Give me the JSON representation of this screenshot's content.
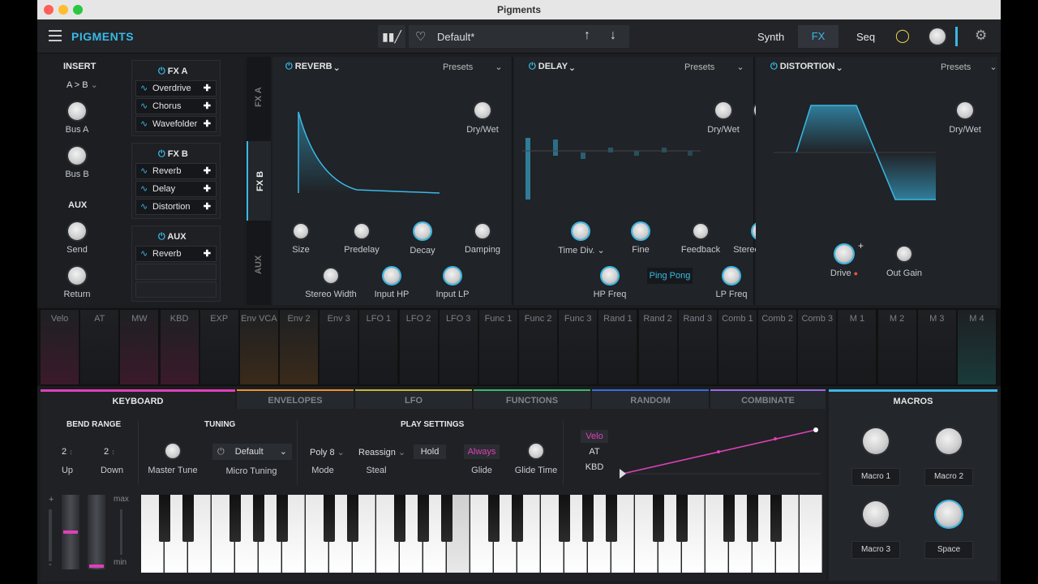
{
  "window": {
    "title": "Pigments"
  },
  "topbar": {
    "logo": "PIGMENTS",
    "preset_name": "Default*",
    "nav_synth": "Synth",
    "nav_fx": "FX",
    "nav_seq": "Seq"
  },
  "insert": {
    "title": "INSERT",
    "routing": "A > B",
    "bus_a": "Bus A",
    "bus_b": "Bus B",
    "aux_title": "AUX",
    "send": "Send",
    "return": "Return",
    "fxa_title": "FX A",
    "fxa_slots": [
      "Overdrive",
      "Chorus",
      "Wavefolder"
    ],
    "fxb_title": "FX B",
    "fxb_slots": [
      "Reverb",
      "Delay",
      "Distortion"
    ],
    "aux_box_title": "AUX",
    "aux_slots": [
      "Reverb"
    ]
  },
  "vtabs": {
    "fxa": "FX A",
    "fxb": "FX B",
    "aux": "AUX"
  },
  "reverb": {
    "title": "REVERB",
    "presets": "Presets",
    "dry_wet": "Dry/Wet",
    "size": "Size",
    "predelay": "Predelay",
    "decay": "Decay",
    "damping": "Damping",
    "stereo_width": "Stereo Width",
    "input_hp": "Input HP",
    "input_lp": "Input LP"
  },
  "delay": {
    "title": "DELAY",
    "presets": "Presets",
    "dry_wet": "Dry/Wet",
    "time_div": "Time Div.",
    "fine": "Fine",
    "feedback": "Feedback",
    "stereo_width": "Stereo Width",
    "hp_freq": "HP Freq",
    "ping_pong": "Ping Pong",
    "lp_freq": "LP Freq"
  },
  "distortion": {
    "title": "DISTORTION",
    "presets": "Presets",
    "dry_wet": "Dry/Wet",
    "drive": "Drive",
    "out_gain": "Out Gain"
  },
  "mod_sources": [
    "Velo",
    "AT",
    "MW",
    "KBD",
    "EXP",
    "Env VCA",
    "Env 2",
    "Env 3",
    "LFO 1",
    "LFO 2",
    "LFO 3",
    "Func 1",
    "Func 2",
    "Func 3",
    "Rand 1",
    "Rand 2",
    "Rand 3",
    "Comb 1",
    "Comb 2",
    "Comb 3",
    "M 1",
    "M 2",
    "M 3",
    "M 4"
  ],
  "tabs": [
    "KEYBOARD",
    "ENVELOPES",
    "LFO",
    "FUNCTIONS",
    "RANDOM",
    "COMBINATE"
  ],
  "macros_title": "MACROS",
  "keyboard": {
    "bend_range": "BEND RANGE",
    "up_value": "2",
    "down_value": "2",
    "up": "Up",
    "down": "Down",
    "tuning": "TUNING",
    "master_tune": "Master Tune",
    "tuning_preset": "Default",
    "micro_tuning": "Micro Tuning",
    "play_settings": "PLAY SETTINGS",
    "poly": "Poly 8",
    "mode": "Mode",
    "reassign": "Reassign",
    "steal": "Steal",
    "hold": "Hold",
    "always": "Always",
    "glide": "Glide",
    "glide_time": "Glide Time",
    "velo": "Velo",
    "at": "AT",
    "kbd": "KBD",
    "max": "max",
    "min": "min",
    "plus": "+",
    "minus": "-"
  },
  "macros": [
    "Macro 1",
    "Macro 2",
    "Macro 3",
    "Space"
  ],
  "colors": {
    "accent": "#3ab8e6",
    "magenta": "#e040b8",
    "bg": "#1b1d20"
  }
}
